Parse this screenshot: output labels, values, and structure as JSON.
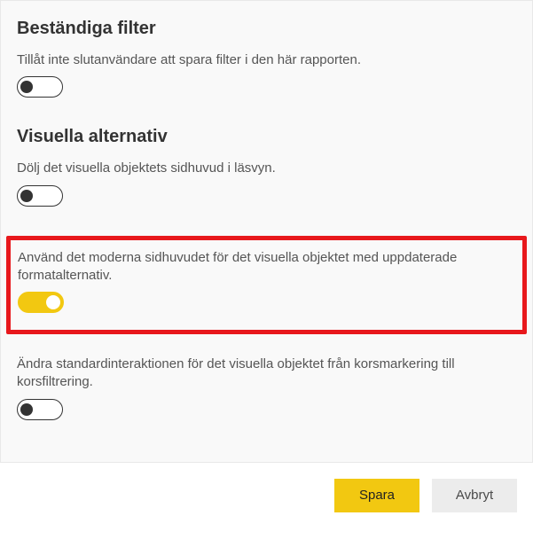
{
  "sections": {
    "persistent_filters": {
      "heading": "Beständiga filter",
      "option1": {
        "desc": "Tillåt inte slutanvändare att spara filter i den här rapporten.",
        "value": false
      }
    },
    "visual_options": {
      "heading": "Visuella alternativ",
      "option1": {
        "desc": "Dölj det visuella objektets sidhuvud i läsvyn.",
        "value": false
      },
      "option2": {
        "desc": "Använd det moderna sidhuvudet för det visuella objektet med uppdaterade formatalternativ.",
        "value": true
      },
      "option3": {
        "desc": "Ändra standardinteraktionen för det visuella objektet från korsmarkering till korsfiltrering.",
        "value": false
      }
    }
  },
  "buttons": {
    "save": "Spara",
    "cancel": "Avbryt"
  }
}
